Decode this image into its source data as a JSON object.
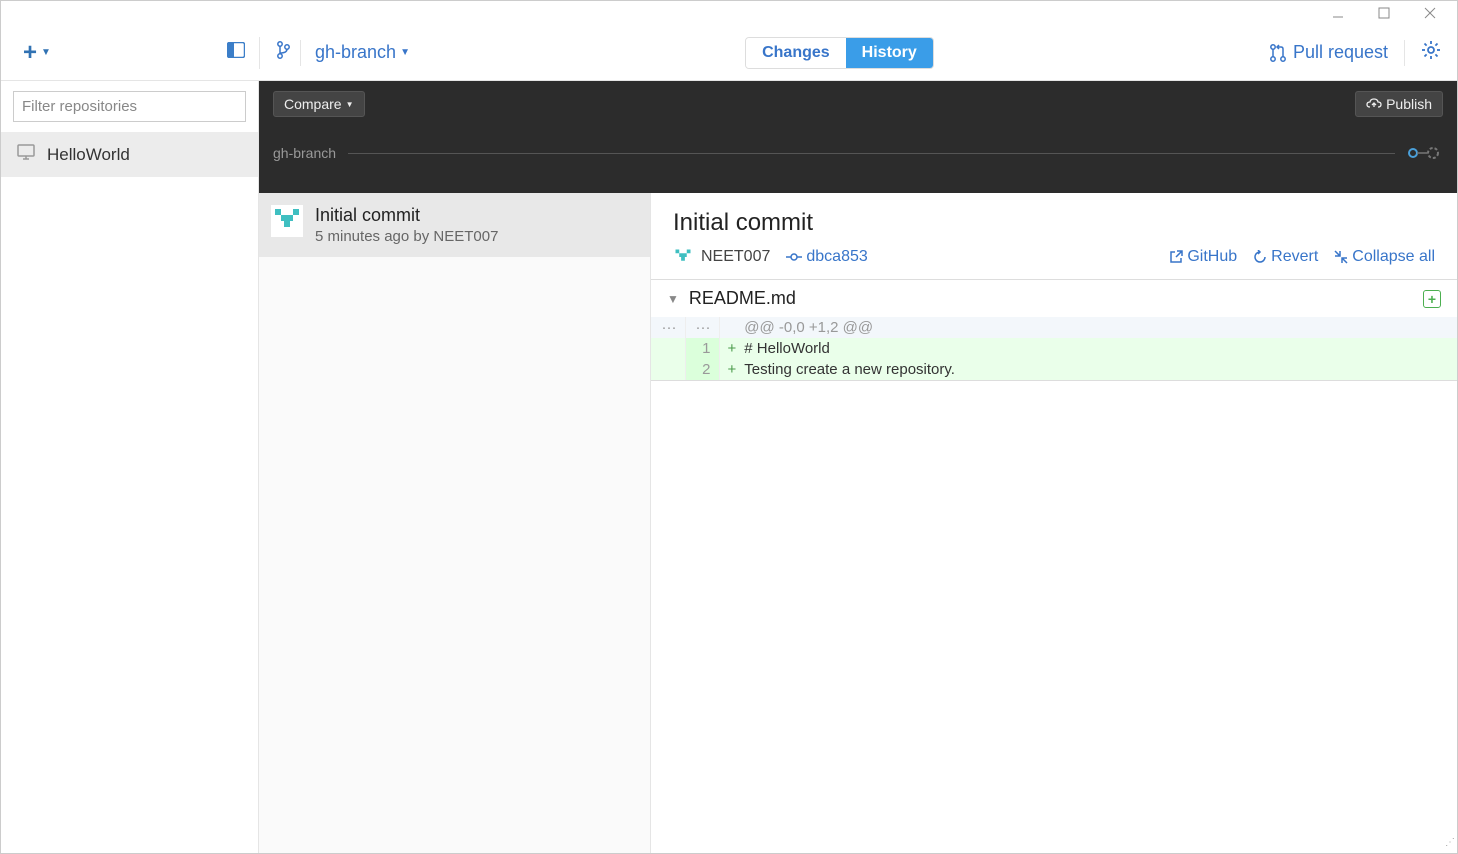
{
  "window": {
    "minimize": "—",
    "maximize": "☐",
    "close": "✕"
  },
  "topbar": {
    "add_label": "+",
    "branch_name": "gh-branch",
    "changes_label": "Changes",
    "history_label": "History",
    "pull_request_label": "Pull request"
  },
  "sidebar": {
    "filter_placeholder": "Filter repositories",
    "repos": [
      {
        "name": "HelloWorld"
      }
    ]
  },
  "compare_strip": {
    "compare_label": "Compare",
    "publish_label": "Publish",
    "branch_label": "gh-branch"
  },
  "commit_list": [
    {
      "title": "Initial commit",
      "meta": "5 minutes ago by NEET007"
    }
  ],
  "commit_detail": {
    "title": "Initial commit",
    "author": "NEET007",
    "sha": "dbca853",
    "actions": {
      "github": "GitHub",
      "revert": "Revert",
      "collapse": "Collapse all"
    },
    "file": {
      "name": "README.md",
      "hunk": "@@ -0,0 +1,2 @@",
      "lines": [
        {
          "num": "1",
          "text": "# HelloWorld"
        },
        {
          "num": "2",
          "text": "Testing create a new repository."
        }
      ]
    }
  }
}
